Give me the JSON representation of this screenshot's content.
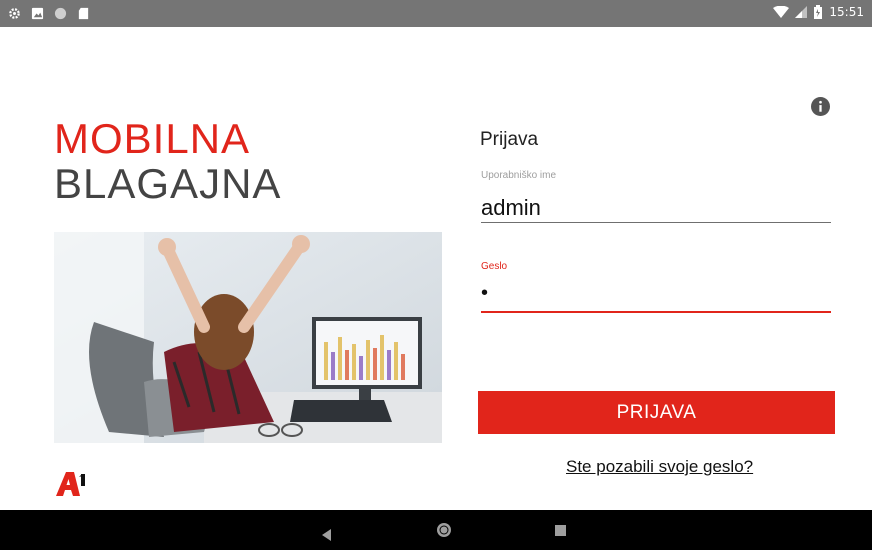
{
  "status_bar": {
    "time": "15:51",
    "icons_left": [
      "settings-icon",
      "image-icon",
      "circle-icon",
      "sd-card-icon"
    ],
    "icons_right": [
      "wifi-icon",
      "signal-icon",
      "battery-icon"
    ]
  },
  "app": {
    "title_line1": "MOBILNA",
    "title_line2": "BLAGAJNA",
    "logo_text": "A",
    "logo_superscript": "1"
  },
  "form": {
    "heading": "Prijava",
    "username_label": "Uporabniško ime",
    "username_value": "admin",
    "password_label": "Geslo",
    "password_value": "•",
    "login_button": "PRIJAVA",
    "forgot_link": "Ste pozabili svoje geslo?"
  },
  "colors": {
    "accent": "#e1251b",
    "status_bar": "#757575",
    "nav_bar": "#000000"
  }
}
